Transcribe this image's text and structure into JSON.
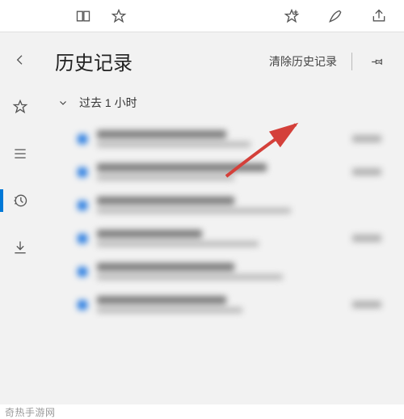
{
  "top_bar": {
    "reading_view": "reading-view-icon",
    "star": "star-icon",
    "add_fav": "add-favorite-icon",
    "notes": "web-notes-icon",
    "share": "share-icon"
  },
  "rail": {
    "back": "chevron-left-icon",
    "favorites": "star-outline-icon",
    "reading_list": "reading-list-icon",
    "history": "history-icon",
    "downloads": "downloads-icon"
  },
  "panel": {
    "title": "历史记录",
    "clear": "清除历史记录",
    "section_past_hour": "过去 1 小时"
  },
  "history_items": [
    {
      "title_w": 160,
      "sub_w": 190,
      "time": true
    },
    {
      "title_w": 210,
      "sub_w": 170,
      "time": true
    },
    {
      "title_w": 170,
      "sub_w": 240,
      "time": false
    },
    {
      "title_w": 130,
      "sub_w": 200,
      "time": true
    },
    {
      "title_w": 170,
      "sub_w": 230,
      "time": false
    },
    {
      "title_w": 160,
      "sub_w": 180,
      "time": true
    }
  ],
  "watermark": "奇热手游网",
  "colors": {
    "accent": "#0078d7",
    "arrow": "#d4403a"
  }
}
